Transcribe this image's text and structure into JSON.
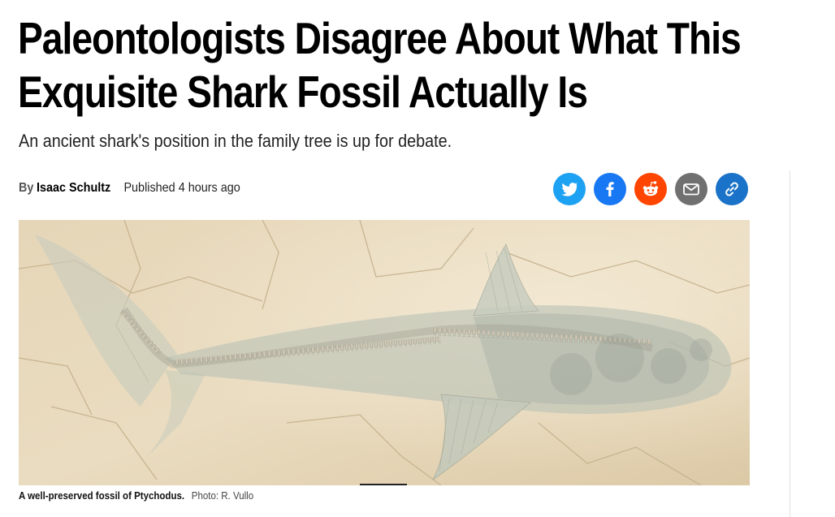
{
  "article": {
    "headline": "Paleontologists Disagree About What This Exquisite Shark Fossil Actually Is",
    "subheadline": "An ancient shark's position in the family tree is up for debate.",
    "byline_prefix": "By",
    "author": "Isaac Schultz",
    "published": "Published 4 hours ago"
  },
  "share": {
    "buttons": [
      {
        "icon": "twitter-icon",
        "color": "#1da1f2"
      },
      {
        "icon": "facebook-icon",
        "color": "#1877f2"
      },
      {
        "icon": "reddit-icon",
        "color": "#ff4500"
      },
      {
        "icon": "email-icon",
        "color": "#707070"
      },
      {
        "icon": "link-icon",
        "color": "#1a73c8"
      }
    ]
  },
  "media": {
    "caption": "A well-preserved fossil of Ptychodus.",
    "credit": "Photo: R. Vullo"
  }
}
